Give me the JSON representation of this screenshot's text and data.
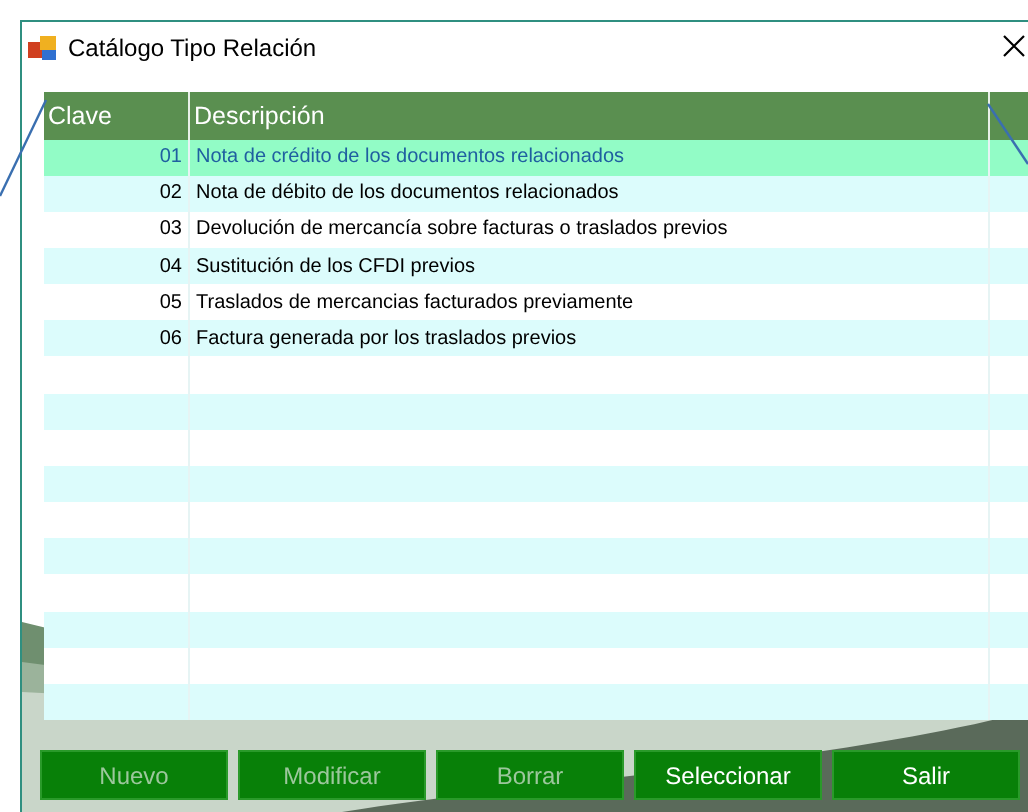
{
  "window": {
    "title": "Catálogo Tipo Relación"
  },
  "table": {
    "columns": [
      "Clave",
      "Descripción"
    ],
    "rows": [
      {
        "clave": "01",
        "descripcion": "Nota de crédito de los documentos relacionados",
        "selected": true
      },
      {
        "clave": "02",
        "descripcion": "Nota de débito de los documentos relacionados",
        "selected": false
      },
      {
        "clave": "03",
        "descripcion": "Devolución de mercancía sobre facturas o traslados previos",
        "selected": false
      },
      {
        "clave": "04",
        "descripcion": "Sustitución de los CFDI previos",
        "selected": false
      },
      {
        "clave": "05",
        "descripcion": "Traslados de mercancias facturados previamente",
        "selected": false
      },
      {
        "clave": "06",
        "descripcion": "Factura generada por los traslados previos",
        "selected": false
      }
    ]
  },
  "buttons": [
    {
      "label": "Nuevo",
      "disabled": true
    },
    {
      "label": "Modificar",
      "disabled": true
    },
    {
      "label": "Borrar",
      "disabled": true
    },
    {
      "label": "Seleccionar",
      "disabled": false
    },
    {
      "label": "Salir",
      "disabled": false
    }
  ]
}
